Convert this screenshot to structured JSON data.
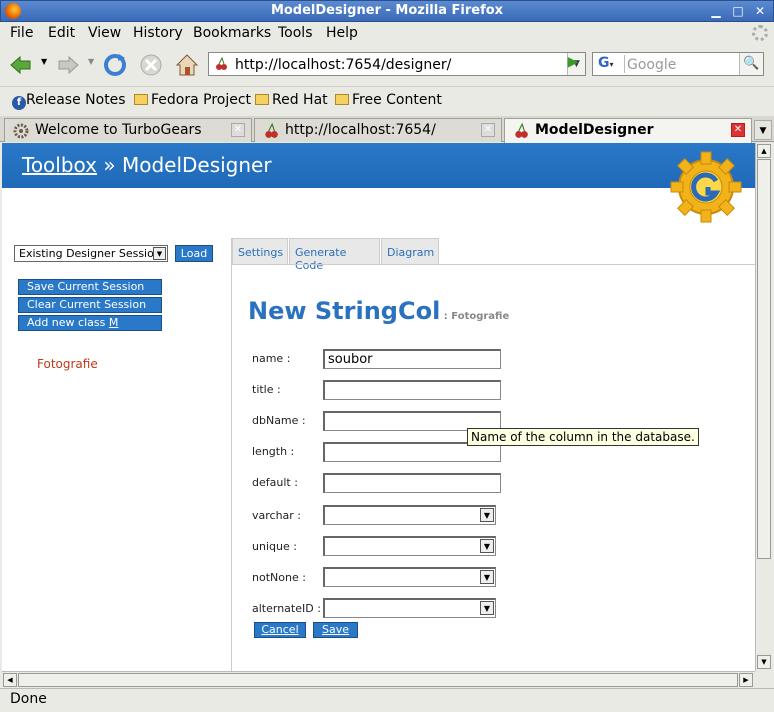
{
  "window": {
    "title": "ModelDesigner - Mozilla Firefox"
  },
  "menu": [
    "File",
    "Edit",
    "View",
    "History",
    "Bookmarks",
    "Tools",
    "Help"
  ],
  "navigation": {
    "url": "http://localhost:7654/designer/",
    "search_placeholder": "Google"
  },
  "bookmarks": [
    {
      "label": "Release Notes",
      "icon": "fedora-icon"
    },
    {
      "label": "Fedora Project",
      "icon": "folder-icon"
    },
    {
      "label": "Red Hat",
      "icon": "folder-icon"
    },
    {
      "label": "Free Content",
      "icon": "folder-icon"
    }
  ],
  "tabs": [
    {
      "label": "Welcome to TurboGears",
      "active": false
    },
    {
      "label": "http://localhost:7654/",
      "active": false
    },
    {
      "label": "ModelDesigner",
      "active": true
    }
  ],
  "page": {
    "breadcrumb_link": "Toolbox",
    "breadcrumb_sep": " » ",
    "breadcrumb_current": "ModelDesigner",
    "session_select_value": "Existing Designer Session",
    "load_label": "Load",
    "sidebar_buttons": [
      "Save Current Session",
      "Clear Current Session",
      "Add new class "
    ],
    "add_class_hotkey": "M",
    "class_link": "Fotografie",
    "content_tabs": [
      "Settings",
      "Generate Code",
      "Diagram"
    ],
    "heading": "New StringCol",
    "heading_sub": " : Fotografie",
    "fields": [
      {
        "label": "name :",
        "type": "text",
        "value": "soubor"
      },
      {
        "label": "title :",
        "type": "text",
        "value": ""
      },
      {
        "label": "dbName :",
        "type": "text",
        "value": ""
      },
      {
        "label": "length :",
        "type": "text",
        "value": ""
      },
      {
        "label": "default :",
        "type": "text",
        "value": ""
      },
      {
        "label": "varchar :",
        "type": "select",
        "value": ""
      },
      {
        "label": "unique :",
        "type": "select",
        "value": ""
      },
      {
        "label": "notNone :",
        "type": "select",
        "value": ""
      },
      {
        "label": "alternateID :",
        "type": "select",
        "value": ""
      }
    ],
    "cancel_label": "Cancel",
    "save_label": "Save",
    "tooltip": "Name of the column in the database."
  },
  "status": "Done",
  "colors": {
    "banner": "#2a78c8",
    "accent_link": "#c0391b",
    "heading": "#2a72c0"
  }
}
